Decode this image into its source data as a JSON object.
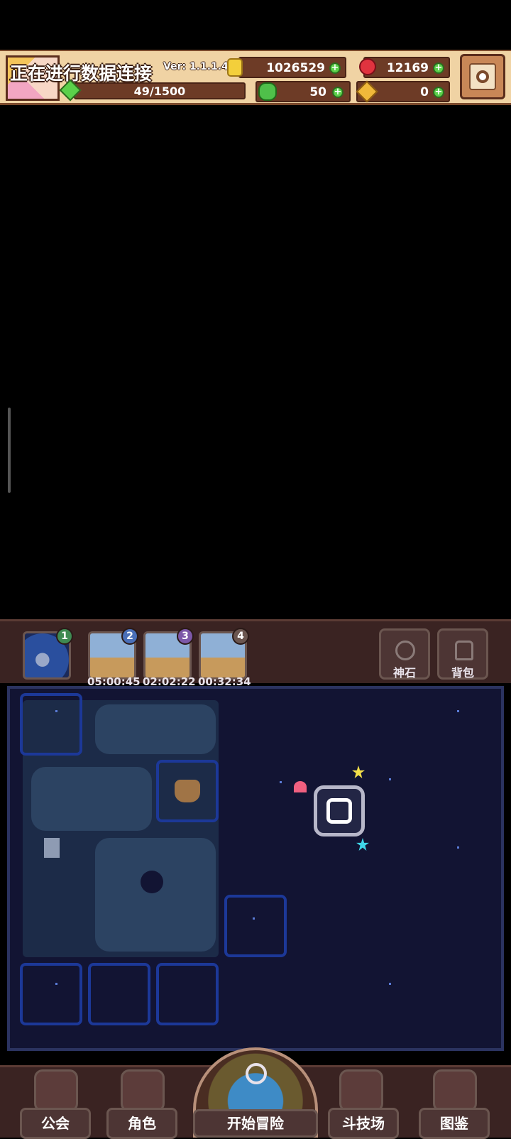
{
  "hud": {
    "status_text": "正在进行数据连接",
    "version": "Ver: 1.1.1.4",
    "gold": "1026529",
    "gems": "12169",
    "exp": "49/1500",
    "clover": "50",
    "key": "0"
  },
  "expedition": {
    "slots": [
      {
        "badge": "1",
        "badge_color": "#3f8a52",
        "timer": ""
      },
      {
        "badge": "2",
        "badge_color": "#4a6fb8",
        "timer": "05:00:45"
      },
      {
        "badge": "3",
        "badge_color": "#7d58a8",
        "timer": "02:02:22"
      },
      {
        "badge": "4",
        "badge_color": "#6b5650",
        "timer": "00:32:34"
      }
    ],
    "god_stone_label": "神石",
    "backpack_label": "背包"
  },
  "nav": {
    "guild": "公会",
    "character": "角色",
    "adventure": "开始冒险",
    "arena": "斗技场",
    "codex": "图鉴"
  },
  "colors": {
    "map_bg": "#121433",
    "tile_border": "#1c3898",
    "panel": "#3a2322",
    "hud": "#f0d3a4"
  },
  "icons": [
    "coin-icon",
    "red-gem-icon",
    "clover-icon",
    "key-icon",
    "settings-gear-icon",
    "horned-helmet-icon",
    "portal-icon",
    "magnifier-icon",
    "swords-icon",
    "book-icon",
    "shop-icon"
  ]
}
